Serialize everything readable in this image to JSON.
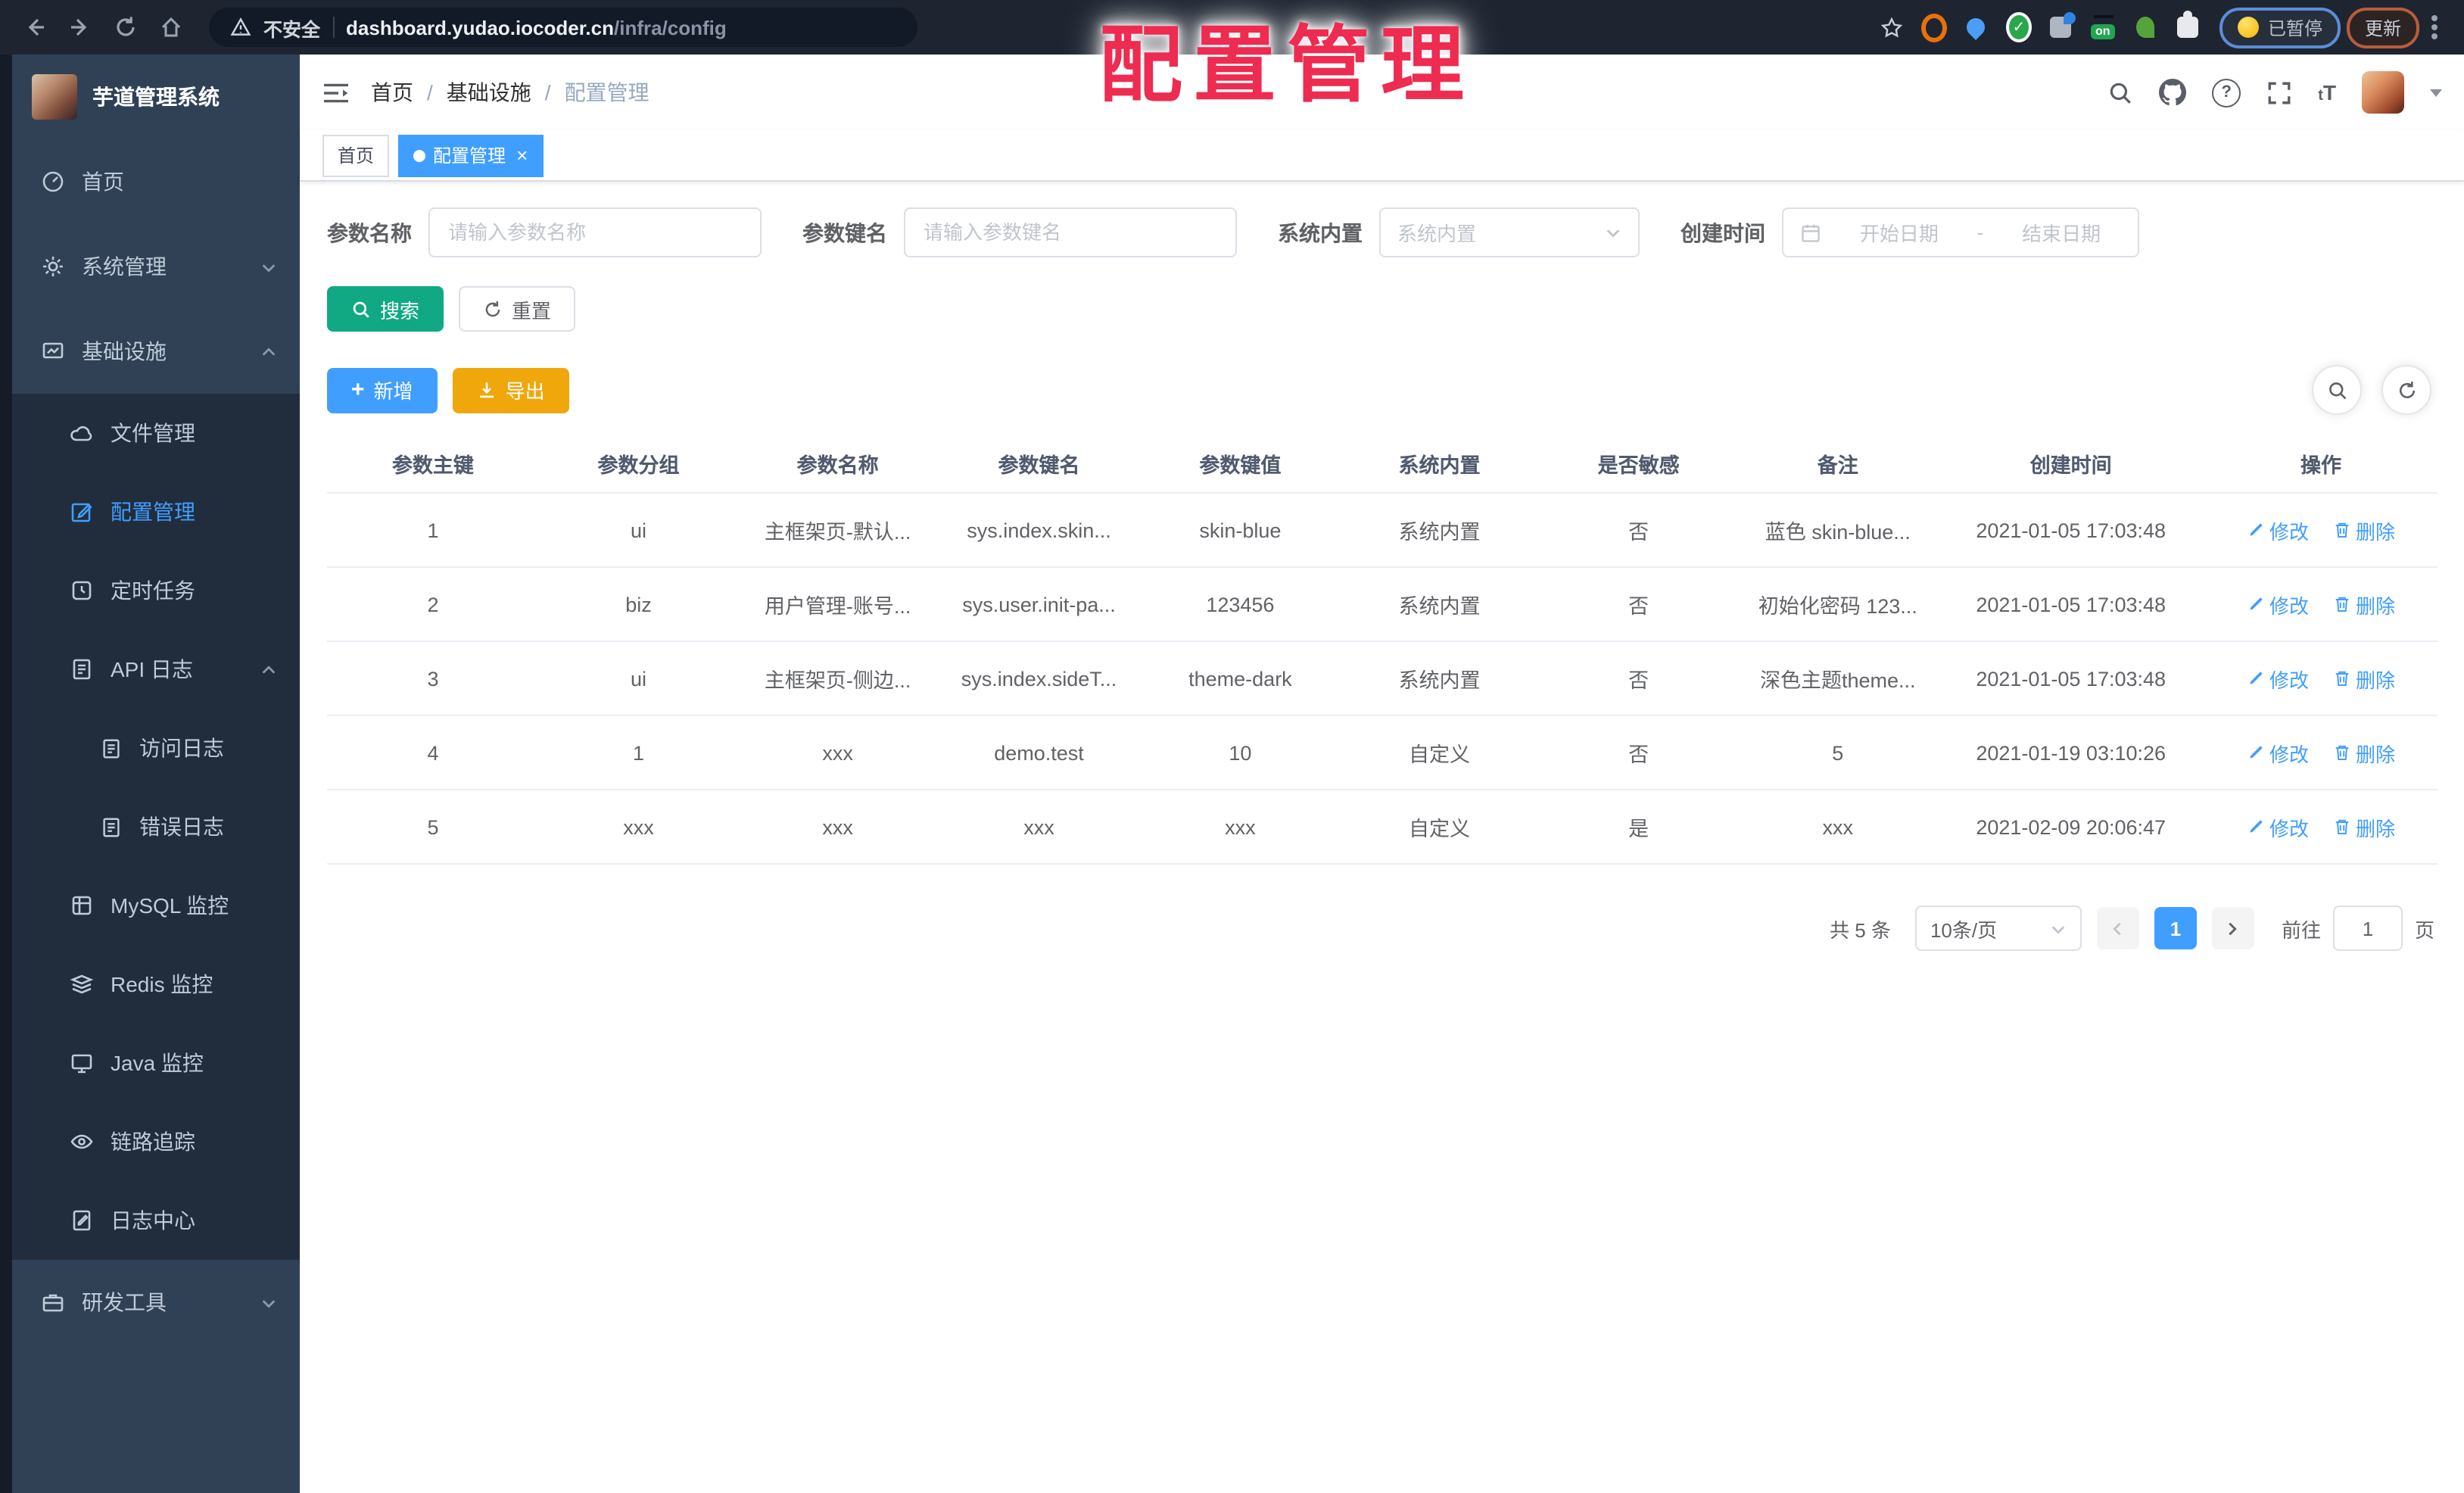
{
  "colors": {
    "accent": "#409eff",
    "search_teal": "#11a983",
    "export_orange": "#f0a70c",
    "overlay_red": "#ee2b50",
    "sidebar_bg": "#304156"
  },
  "browser": {
    "security_label": "不安全",
    "url_host": "dashboard.yudao.iocoder.cn",
    "url_path": "/infra/config",
    "on_badge": "on",
    "paused_badge": "已暂停",
    "update_button": "更新"
  },
  "overlay_title": "配置管理",
  "sidebar": {
    "app_title": "芋道管理系统",
    "home": "首页",
    "system": "系统管理",
    "infra": "基础设施",
    "file": "文件管理",
    "config": "配置管理",
    "job": "定时任务",
    "api_log": "API 日志",
    "access_log": "访问日志",
    "error_log": "错误日志",
    "mysql": "MySQL 监控",
    "redis": "Redis 监控",
    "java": "Java 监控",
    "trace": "链路追踪",
    "log_center": "日志中心",
    "dev_tools": "研发工具"
  },
  "header": {
    "fontsize_glyph_small": "t",
    "fontsize_glyph_big": "T",
    "help_glyph": "?"
  },
  "breadcrumb": [
    "首页",
    "基础设施",
    "配置管理"
  ],
  "breadcrumb_sep": "/",
  "tabs": {
    "home": "首页",
    "current": "配置管理",
    "close_glyph": "×"
  },
  "filters": {
    "name_label": "参数名称",
    "name_placeholder": "请输入参数名称",
    "key_label": "参数键名",
    "key_placeholder": "请输入参数键名",
    "type_label": "系统内置",
    "type_placeholder": "系统内置",
    "date_label": "创建时间",
    "date_start_placeholder": "开始日期",
    "date_separator": "-",
    "date_end_placeholder": "结束日期"
  },
  "actions": {
    "search": "搜索",
    "reset": "重置",
    "add": "新增",
    "add_glyph": "+",
    "export": "导出"
  },
  "table": {
    "columns": [
      "参数主键",
      "参数分组",
      "参数名称",
      "参数键名",
      "参数键值",
      "系统内置",
      "是否敏感",
      "备注",
      "创建时间",
      "操作"
    ],
    "edit_label": "修改",
    "delete_label": "删除",
    "rows": [
      {
        "id": "1",
        "group": "ui",
        "name": "主框架页-默认...",
        "key": "sys.index.skin...",
        "value": "skin-blue",
        "builtin": "系统内置",
        "sensitive": "否",
        "remark": "蓝色 skin-blue...",
        "created": "2021-01-05 17:03:48"
      },
      {
        "id": "2",
        "group": "biz",
        "name": "用户管理-账号...",
        "key": "sys.user.init-pa...",
        "value": "123456",
        "builtin": "系统内置",
        "sensitive": "否",
        "remark": "初始化密码 123...",
        "created": "2021-01-05 17:03:48"
      },
      {
        "id": "3",
        "group": "ui",
        "name": "主框架页-侧边...",
        "key": "sys.index.sideT...",
        "value": "theme-dark",
        "builtin": "系统内置",
        "sensitive": "否",
        "remark": "深色主题theme...",
        "created": "2021-01-05 17:03:48"
      },
      {
        "id": "4",
        "group": "1",
        "name": "xxx",
        "key": "demo.test",
        "value": "10",
        "builtin": "自定义",
        "sensitive": "否",
        "remark": "5",
        "created": "2021-01-19 03:10:26"
      },
      {
        "id": "5",
        "group": "xxx",
        "name": "xxx",
        "key": "xxx",
        "value": "xxx",
        "builtin": "自定义",
        "sensitive": "是",
        "remark": "xxx",
        "created": "2021-02-09 20:06:47"
      }
    ]
  },
  "pagination": {
    "total": "共 5 条",
    "page_size": "10条/页",
    "current_page": "1",
    "goto_label": "前往",
    "goto_value": "1",
    "page_unit": "页"
  }
}
